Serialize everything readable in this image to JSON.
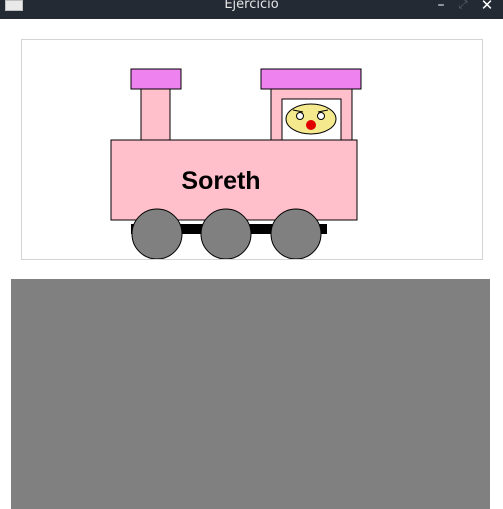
{
  "window": {
    "title": "Ejercicio",
    "controls": {
      "minimize": "–",
      "maximize": "⤢",
      "close": "✕"
    }
  },
  "train": {
    "label": "Soreth",
    "colors": {
      "body": "#ffc0cb",
      "roof": "#ee82ee",
      "wheel": "#808080",
      "axle": "#000000",
      "face": "#f5e98e",
      "nose": "#e00000"
    }
  },
  "bottom_panel": {
    "color": "#808080"
  }
}
